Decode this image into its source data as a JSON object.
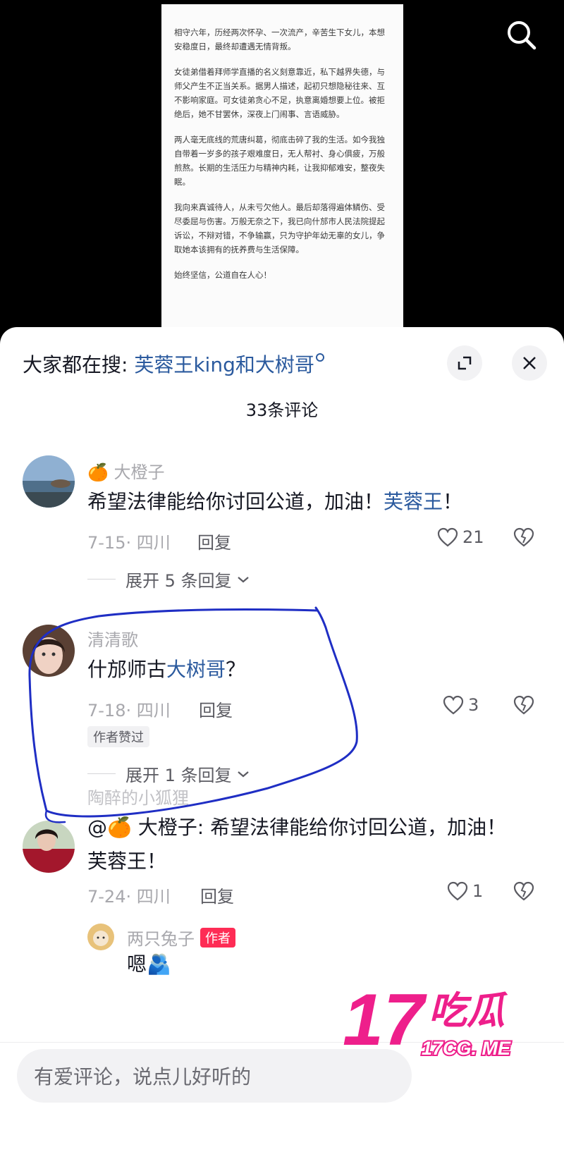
{
  "document": {
    "paragraphs": [
      "相守六年，历经两次怀孕、一次流产，辛苦生下女儿，本想安稳度日，最终却遭遇无情背叛。",
      "女徒弟借着拜师学直播的名义刻意靠近，私下越界失德，与师父产生不正当关系。据男人描述，起初只想隐秘往来、互不影响家庭。可女徒弟贪心不足，执意离婚想要上位。被拒绝后，她不甘罢休，深夜上门闹事、言语威胁。",
      "两人毫无底线的荒唐纠葛，彻底击碎了我的生活。如今我独自带着一岁多的孩子艰难度日，无人帮衬、身心俱疲，万般煎熬。长期的生活压力与精神内耗，让我抑郁难安，整夜失眠。",
      "我向来真诚待人，从未亏欠他人。最后却落得遍体鳞伤、受尽委屈与伤害。万般无奈之下，我已向什邡市人民法院提起诉讼，不辩对错，不争输赢，只为守护年幼无辜的女儿，争取她本该拥有的抚养费与生活保障。",
      "始终坚信，公道自在人心！"
    ]
  },
  "header": {
    "trending_prefix": "大家都在搜: ",
    "trending_keyword": "芙蓉王king和大树哥",
    "comment_count": "33条评论"
  },
  "comments": [
    {
      "user": "🍊 大橙子",
      "text_main": "希望法律能给你讨回公道，加油！",
      "text_kw": "芙蓉王",
      "text_tail": "！",
      "date": "7-15· 四川",
      "reply": "回复",
      "likes": "21",
      "expand": "展开 5 条回复"
    },
    {
      "user": "清清歌",
      "text_main": "什邡师古",
      "text_kw": "大树哥",
      "text_tail": "？",
      "date": "7-18· 四川",
      "reply": "回复",
      "likes": "3",
      "badge": "作者赞过",
      "expand": "展开 1 条回复"
    },
    {
      "user": "陶醉的小狐狸",
      "text": "@🍊 大橙子: 希望法律能给你讨回公道，加油！芙蓉王！",
      "date": "7-24· 四川",
      "reply": "回复",
      "likes": "1"
    }
  ],
  "sub_reply": {
    "user": "两只兔子",
    "tag": "作者",
    "text": "嗯🫂"
  },
  "input": {
    "placeholder": "有爱评论，说点儿好听的"
  },
  "watermark": {
    "big": "17",
    "word": "吃瓜",
    "domain": "17CG. ME"
  },
  "colors": {
    "keyword": "#2b5a9e",
    "author_tag": "#fe2c55",
    "watermark": "#ee1f8b",
    "annotation": "#1f2ec4"
  }
}
